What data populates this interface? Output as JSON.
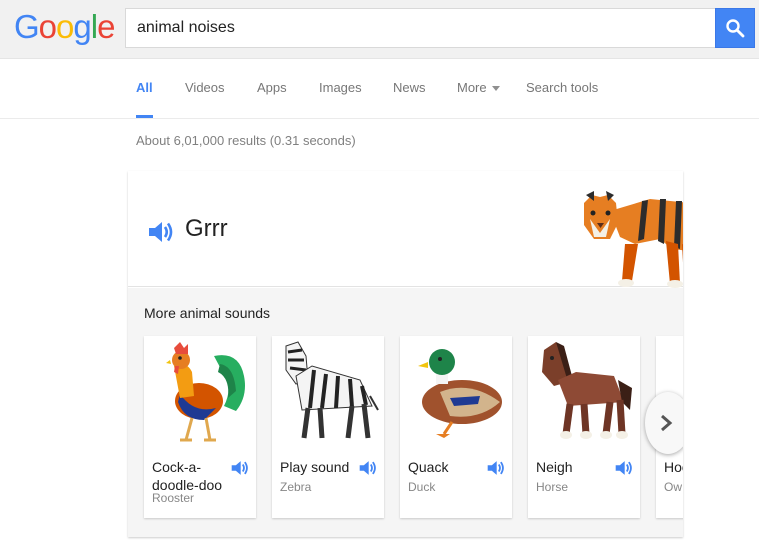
{
  "logo": {
    "letters": [
      "G",
      "o",
      "o",
      "g",
      "l",
      "e"
    ]
  },
  "search": {
    "query": "animal noises"
  },
  "nav": {
    "tabs": [
      {
        "label": "All",
        "active": true
      },
      {
        "label": "Videos"
      },
      {
        "label": "Apps"
      },
      {
        "label": "Images"
      },
      {
        "label": "News"
      },
      {
        "label": "More",
        "dropdown": true
      },
      {
        "label": "Search tools"
      }
    ]
  },
  "result_stats": "About 6,01,000 results (0.31 seconds)",
  "card": {
    "sound_title": "Grrr",
    "featured_animal_icon": "tiger",
    "more_label": "More animal sounds",
    "animals": [
      {
        "sound": "Cock-a-doodle-doo",
        "name": "Rooster",
        "icon": "rooster"
      },
      {
        "sound": "Play sound",
        "name": "Zebra",
        "icon": "zebra"
      },
      {
        "sound": "Quack",
        "name": "Duck",
        "icon": "duck"
      },
      {
        "sound": "Neigh",
        "name": "Horse",
        "icon": "horse"
      },
      {
        "sound": "Hoo",
        "name": "Ow",
        "icon": "owl"
      }
    ]
  },
  "colors": {
    "accent": "#4285f4",
    "speaker": "#4285f4"
  }
}
